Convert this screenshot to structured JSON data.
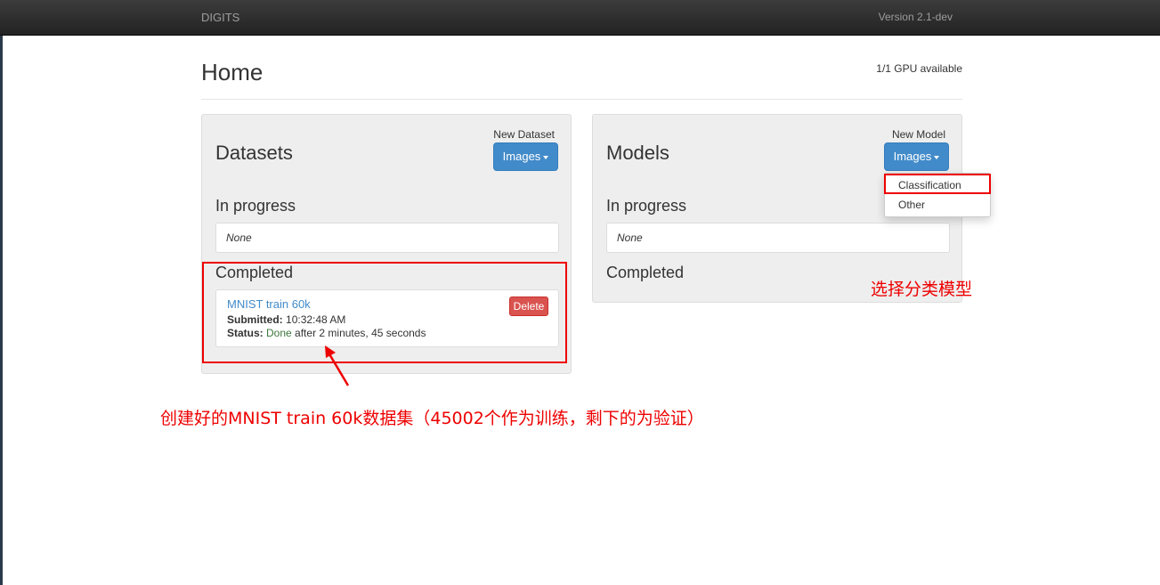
{
  "navbar": {
    "brand": "DIGITS",
    "version": "Version 2.1-dev"
  },
  "page": {
    "title": "Home",
    "gpu_status": "1/1 GPU available"
  },
  "datasets": {
    "title": "Datasets",
    "new_label": "New Dataset",
    "button_label": "Images",
    "in_progress_heading": "In progress",
    "in_progress_empty": "None",
    "completed_heading": "Completed",
    "jobs": [
      {
        "name": "MNIST train 60k",
        "submitted_label": "Submitted:",
        "submitted_value": "10:32:48 AM",
        "status_label": "Status:",
        "status_value": "Done",
        "status_detail": "after 2 minutes, 45 seconds",
        "delete_label": "Delete"
      }
    ]
  },
  "models": {
    "title": "Models",
    "new_label": "New Model",
    "button_label": "Images",
    "in_progress_heading": "In progress",
    "in_progress_empty": "None",
    "completed_heading": "Completed",
    "dropdown": [
      "Classification",
      "Other"
    ]
  },
  "annotations": {
    "select_model": "选择分类模型",
    "dataset_note": "创建好的MNIST train 60k数据集（45002个作为训练，剩下的为验证）"
  },
  "colors": {
    "navbar": "#222222",
    "primary": "#428bca",
    "danger": "#d9534f",
    "success": "#3c763d",
    "annotation": "#ee0000"
  },
  "icons": {
    "dropdown": "caret-down-icon",
    "pointer": "arrow-icon"
  }
}
